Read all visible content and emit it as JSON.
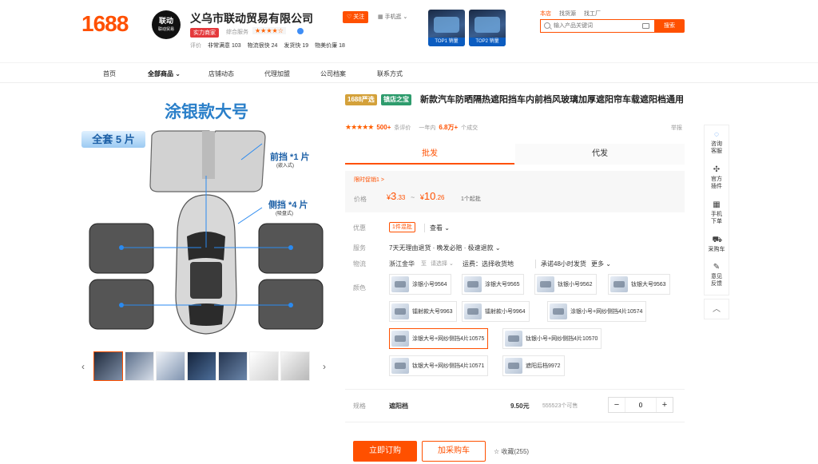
{
  "header": {
    "logo": "1688",
    "shop": {
      "avatar_top": "联动",
      "avatar_bottom": "联动贸易",
      "name": "义乌市联动贸易有限公司",
      "badge": "实力商家",
      "score_label": "综合服务",
      "score_stars": "★★★★☆",
      "ratings_label": "评价",
      "ratings": [
        {
          "label": "非常满意",
          "value": "103"
        },
        {
          "label": "物流很快",
          "value": "24"
        },
        {
          "label": "发货快",
          "value": "19"
        },
        {
          "label": "物美价廉",
          "value": "18"
        }
      ]
    },
    "follow_label": "关注",
    "phone_label": "手机逛",
    "promos": [
      {
        "tag": "TOP1 销量"
      },
      {
        "tag": "TOP2 销量"
      }
    ],
    "search": {
      "tabs": [
        "本店",
        "找货源",
        "找工厂"
      ],
      "placeholder": "输入产品关键词",
      "button": "搜索"
    }
  },
  "nav": [
    "首页",
    "全部商品",
    "店铺动态",
    "代理加盟",
    "公司档案",
    "联系方式"
  ],
  "gallery": {
    "title": "涂银款大号",
    "set": "全套 5 片",
    "front_label": "前挡 *1 片",
    "front_sub": "(嵌入式)",
    "side_label": "侧挡 *4 片",
    "side_sub": "(吸盘式)"
  },
  "product": {
    "tags": [
      "1688严选",
      "镇店之宝"
    ],
    "title": "新款汽车防晒隔热遮阳挡车内前档风玻璃加厚遮阳帘车载遮阳档通用",
    "stars": "★★★★★",
    "rating": "500+",
    "reviews_label": "条评价",
    "sales_prefix": "一年内",
    "sales": "6.8万+",
    "sales_suffix": "个成交",
    "report": "举报",
    "tabs": [
      "批发",
      "代发"
    ],
    "promo_line": "限时促销1 >",
    "price_label": "价格",
    "price_low": "3",
    "price_low_dec": ".33",
    "price_high": "10",
    "price_high_dec": ".26",
    "currency": "¥",
    "price_sep": "~",
    "moq": "1个起批",
    "discount_label": "优惠",
    "discount": "1件混批",
    "discount_more": "查看",
    "service_label": "服务",
    "service": "7天无理由退货 · 晚发必赔 · 极速退款",
    "logistics_label": "物流",
    "origin": "浙江金华",
    "to_label": "至",
    "to_value": "请选择",
    "freight": "运费：选择收货地",
    "ship": "承诺48小时发货",
    "ship_more": "更多",
    "color_label": "颜色",
    "colors": [
      "涂银小号9564",
      "涂银大号9565",
      "钛银小号9562",
      "钛银大号9563",
      "镭射款大号9963",
      "镭射款小号9964",
      "涂银小号+网纱侧挡4片10574",
      "涂银大号+网纱侧挡4片10575",
      "钛银小号+网纱侧挡4片10570",
      "钛银大号+网纱侧挡4片10571",
      "遮阳后档9972"
    ],
    "spec_label": "规格",
    "spec_name": "遮阳档",
    "spec_price": "9.50元",
    "spec_stock": "555523个可售",
    "qty_minus": "−",
    "qty_plus": "+",
    "qty_value": "0",
    "buy_label": "立即订购",
    "cart_label": "加采购车",
    "fav_label": "收藏(255)"
  },
  "sidebar": [
    {
      "icon": "chat-icon",
      "label1": "咨询",
      "label2": "客服"
    },
    {
      "icon": "plugin-icon",
      "label1": "官方",
      "label2": "插件"
    },
    {
      "icon": "qr-icon",
      "label1": "手机",
      "label2": "下单"
    },
    {
      "icon": "cart-icon",
      "label1": "采购车",
      "label2": ""
    },
    {
      "icon": "edit-icon",
      "label1": "意见",
      "label2": "反馈"
    }
  ],
  "colors": {
    "accent": "#ff5000",
    "title_blue": "#2a7fc9"
  }
}
